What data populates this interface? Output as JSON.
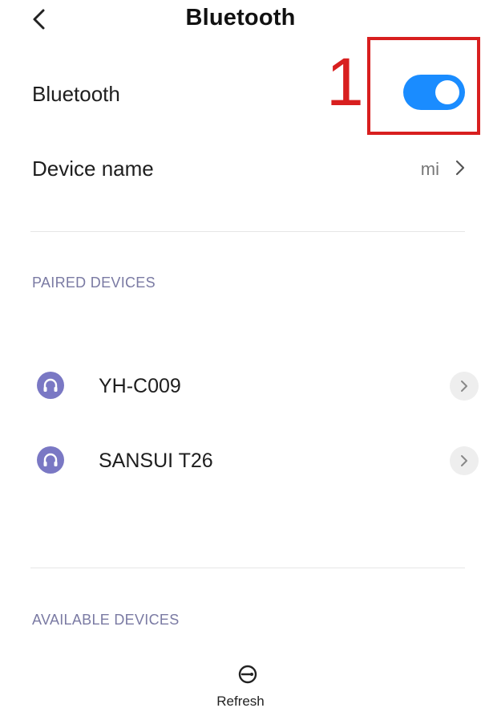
{
  "header": {
    "title": "Bluetooth",
    "back_icon": "chevron-left-icon"
  },
  "bluetooth": {
    "label": "Bluetooth",
    "enabled": true,
    "toggle_color": "#1a8cff"
  },
  "annotation": {
    "number": "1",
    "color": "#d81f1f"
  },
  "device_name": {
    "label": "Device name",
    "value": "mi",
    "chevron_icon": "chevron-right-icon"
  },
  "paired": {
    "header": "PAIRED DEVICES",
    "devices": [
      {
        "name": "YH-C009",
        "icon": "headset-icon"
      },
      {
        "name": "SANSUI T26",
        "icon": "headset-icon"
      }
    ]
  },
  "available": {
    "header": "AVAILABLE DEVICES"
  },
  "footer": {
    "refresh_label": "Refresh",
    "refresh_icon": "refresh-icon"
  }
}
